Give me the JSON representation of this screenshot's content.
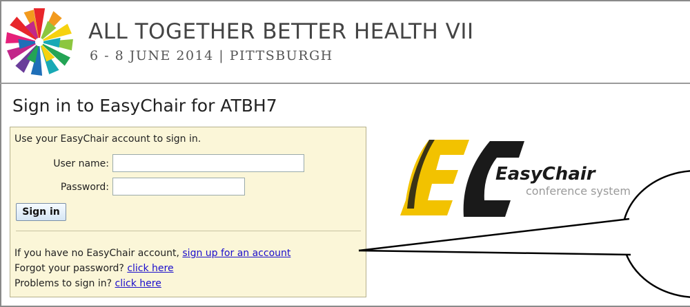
{
  "header": {
    "title": "ALL TOGETHER BETTER HEALTH VII",
    "subtitle": "6 - 8 JUNE 2014 | PITTSBURGH"
  },
  "page": {
    "title": "Sign in to EasyChair for ATBH7"
  },
  "form": {
    "intro": "Use your EasyChair account to sign in.",
    "username_label": "User name:",
    "username_value": "",
    "password_label": "Password:",
    "password_value": "",
    "signin_label": "Sign in"
  },
  "links": {
    "no_account_text": "If you have no EasyChair account,",
    "signup_link": "sign up for an account",
    "forgot_text": "Forgot your password?",
    "forgot_link": "click here",
    "problems_text": "Problems to sign in?",
    "problems_link": "click here"
  },
  "brand": {
    "name": "EasyChair",
    "tagline": "conference system",
    "accent": "#f2c200",
    "dark": "#1a1a1a"
  },
  "colors": {
    "panel_bg": "#fbf6d8",
    "link": "#1a0dcc"
  }
}
